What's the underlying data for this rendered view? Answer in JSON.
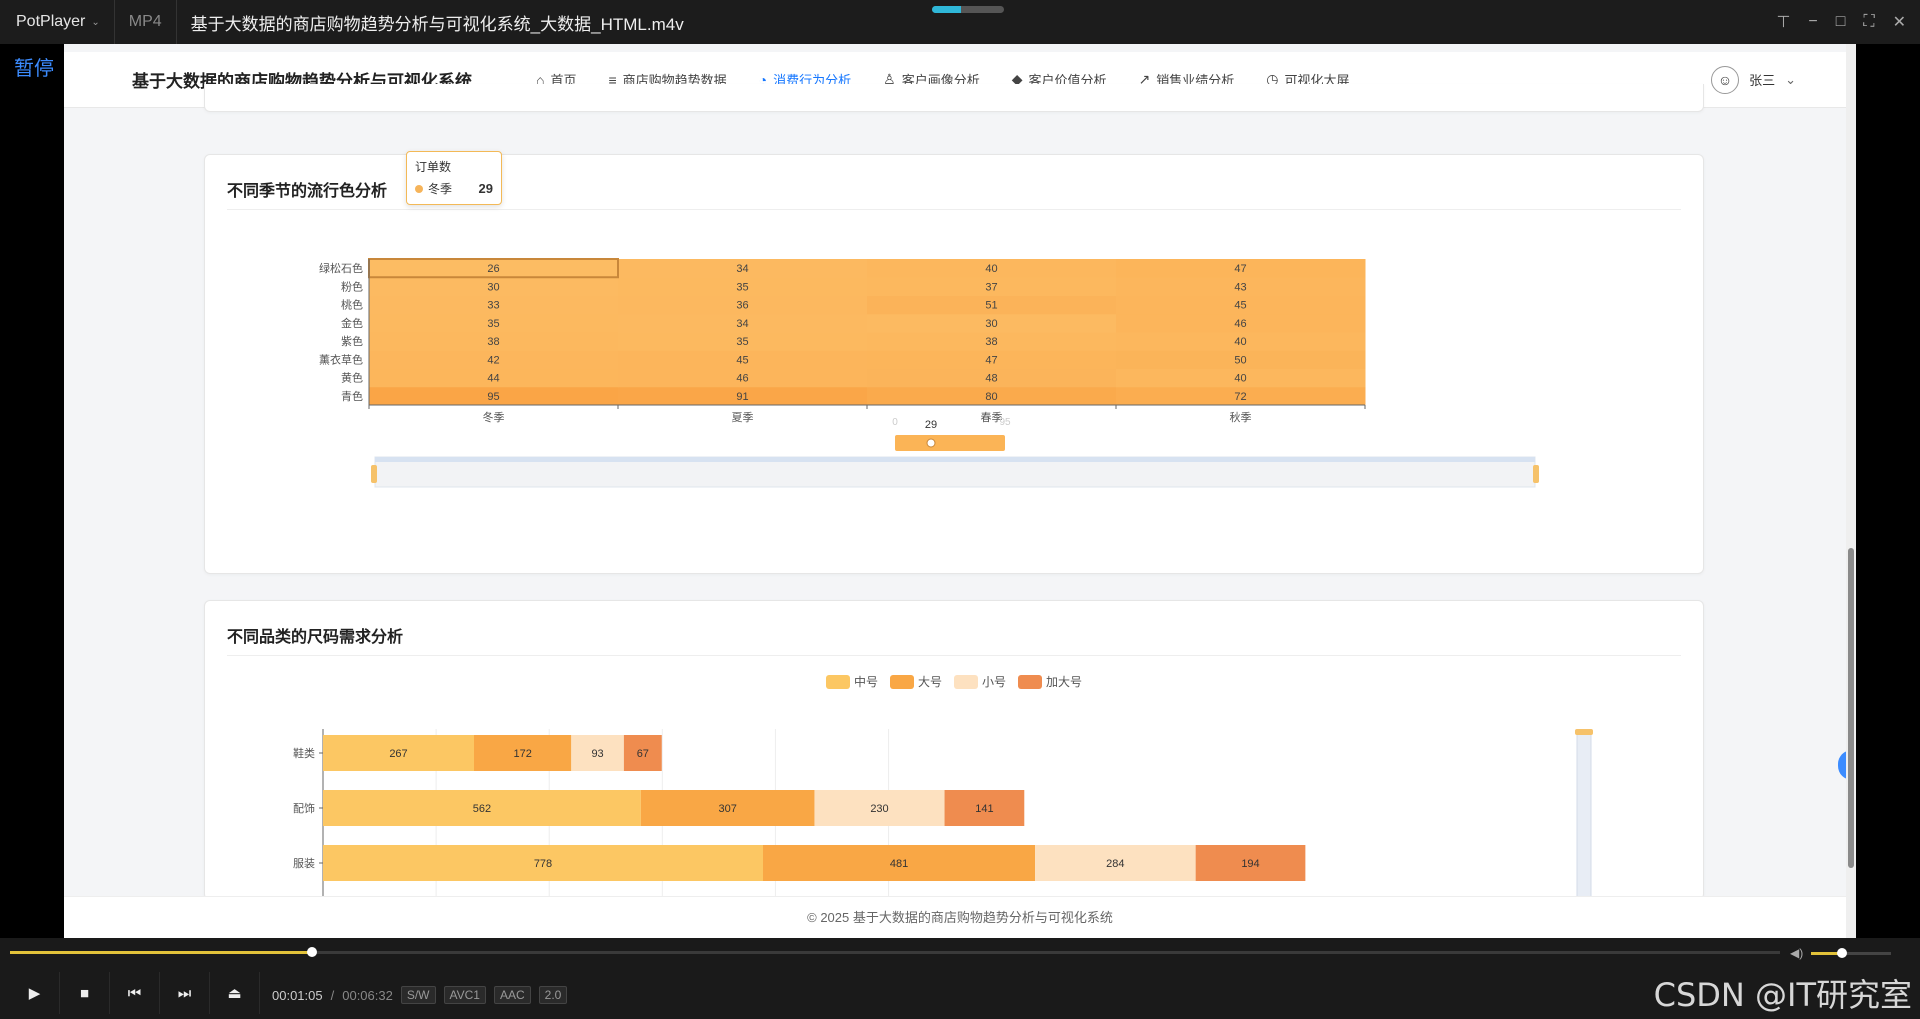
{
  "player": {
    "app_name": "PotPlayer",
    "format": "MP4",
    "file_title": "基于大数据的商店购物趋势分析与可视化系统_大数据_HTML.m4v",
    "pause_label": "暂停",
    "time_current": "00:01:05",
    "time_sep": "/",
    "time_total": "00:06:32",
    "tags": [
      "S/W",
      "AVC1",
      "AAC",
      "2.0"
    ],
    "watermark": "CSDN @IT研究室"
  },
  "nav": {
    "brand": "基于大数据的商店购物趋势分析与可视化系统",
    "items": [
      {
        "label": "首页",
        "icon": "home-icon",
        "glyph": "⌂"
      },
      {
        "label": "商店购物趋势数据",
        "icon": "database-icon",
        "glyph": "≡"
      },
      {
        "label": "消费行为分析",
        "icon": "pie-chart-icon",
        "glyph": "◔"
      },
      {
        "label": "客户画像分析",
        "icon": "user-icon",
        "glyph": "♙"
      },
      {
        "label": "客户价值分析",
        "icon": "diamond-icon",
        "glyph": "◆"
      },
      {
        "label": "销售业绩分析",
        "icon": "line-chart-icon",
        "glyph": "↗"
      },
      {
        "label": "可视化大屏",
        "icon": "dashboard-icon",
        "glyph": "◷"
      }
    ],
    "active_index": 2,
    "user_name": "张三"
  },
  "heatmap_card": {
    "title": "不同季节的流行色分析",
    "tooltip": {
      "title": "订单数",
      "series": "冬季",
      "value": "29"
    },
    "visual_map": {
      "min": "0",
      "max": "95",
      "current": "29"
    }
  },
  "size_card": {
    "title": "不同品类的尺码需求分析"
  },
  "footer": "© 2025 基于大数据的商店购物趋势分析与可视化系统",
  "colors": {
    "accent": "#1677ff",
    "heat": "#fbb456"
  },
  "chart_data": [
    {
      "type": "heatmap",
      "title": "不同季节的流行色分析",
      "x": [
        "冬季",
        "夏季",
        "春季",
        "秋季"
      ],
      "y": [
        "青色",
        "黄色",
        "薰衣草色",
        "紫色",
        "金色",
        "桃色",
        "粉色",
        "绿松石色"
      ],
      "values": [
        [
          95,
          91,
          80,
          72
        ],
        [
          44,
          46,
          48,
          40
        ],
        [
          42,
          45,
          47,
          50
        ],
        [
          38,
          35,
          38,
          40
        ],
        [
          35,
          34,
          30,
          46
        ],
        [
          33,
          36,
          51,
          45
        ],
        [
          30,
          35,
          37,
          43
        ],
        [
          26,
          34,
          40,
          47
        ]
      ],
      "series_name": "订单数"
    },
    {
      "type": "bar",
      "title": "不同品类的尺码需求分析",
      "categories": [
        "服装",
        "配饰",
        "鞋类"
      ],
      "series": [
        {
          "name": "中号",
          "values": [
            778,
            562,
            267
          ],
          "color": "#fcc763"
        },
        {
          "name": "大号",
          "values": [
            481,
            307,
            172
          ],
          "color": "#f9a745"
        },
        {
          "name": "小号",
          "values": [
            284,
            230,
            93
          ],
          "color": "#fde1c0"
        },
        {
          "name": "加大号",
          "values": [
            194,
            141,
            67
          ],
          "color": "#ef8c4f"
        }
      ],
      "stacked": true,
      "orientation": "horizontal",
      "legend": "top-center"
    }
  ]
}
